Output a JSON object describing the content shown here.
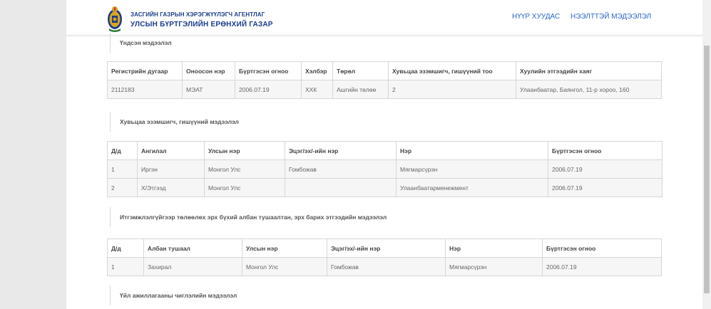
{
  "header": {
    "agency_line": "ЗАСГИЙН ГАЗРЫН ХЭРЭГЖҮҮЛЭГЧ АГЕНТЛАГ",
    "org_name": "УЛСЫН БҮРТГЭЛИЙН ЕРӨНХИЙ ГАЗАР",
    "nav_home": "НҮҮР ХУУДАС",
    "nav_faq": "НЭЭЛТТЭЙ МЭДЭЭЛЭЛ"
  },
  "basic_info": {
    "title": "Үндсэн мэдээлэл",
    "headers": [
      "Регистрийн дугаар",
      "Оноосон нэр",
      "Бүртгэсэн огноо",
      "Хэлбэр",
      "Төрөл",
      "Хувьцаа эзэмшигч, гишүүний тоо",
      "Хуулийн этгээдийн хаяг"
    ],
    "row": [
      "2112183",
      "МЭАТ",
      "2006.07.19",
      "ХХК",
      "Ашгийн төлөө",
      "2",
      "Улаанбаатар, Баянгол, 11-р хороо, 160"
    ]
  },
  "shareholders": {
    "title": "Хувьцаа эзэмшигч, гишүүний мэдээлэл",
    "headers": [
      "Д/д",
      "Ангилал",
      "Улсын нэр",
      "Эцэг/эх/-ийн нэр",
      "Нэр",
      "Бүртгэсэн огноо"
    ],
    "rows": [
      [
        "1",
        "Иргэн",
        "Монгол Улс",
        "Гомбожав",
        "Мягмарсүрэн",
        "2006.07.19"
      ],
      [
        "2",
        "Х/Этгээд",
        "Монгол Улс",
        "",
        "Улаанбаатарменежмент",
        "2006.07.19"
      ]
    ]
  },
  "officials": {
    "title": "Итгэмжлэлгүйгээр төлөөлөх эрх бүхий албан тушаалтан, эрх барих этгээдийн мэдээлэл",
    "headers": [
      "Д/д",
      "Албан тушаал",
      "Улсын нэр",
      "Эцэг/эх/-ийн нэр",
      "Нэр",
      "Бүртгэсэн огноо"
    ],
    "rows": [
      [
        "1",
        "Захирал",
        "Монгол Улс",
        "Гомбожав",
        "Мягмарсүрэн",
        "2006.07.19"
      ]
    ]
  },
  "activities": {
    "title": "Үйл ажиллагааны чиглэлийн мэдээлэл"
  },
  "colors": {
    "brand_blue": "#1c3c8c",
    "link_blue": "#2a66c9",
    "emblem_gold": "#d9a520"
  }
}
